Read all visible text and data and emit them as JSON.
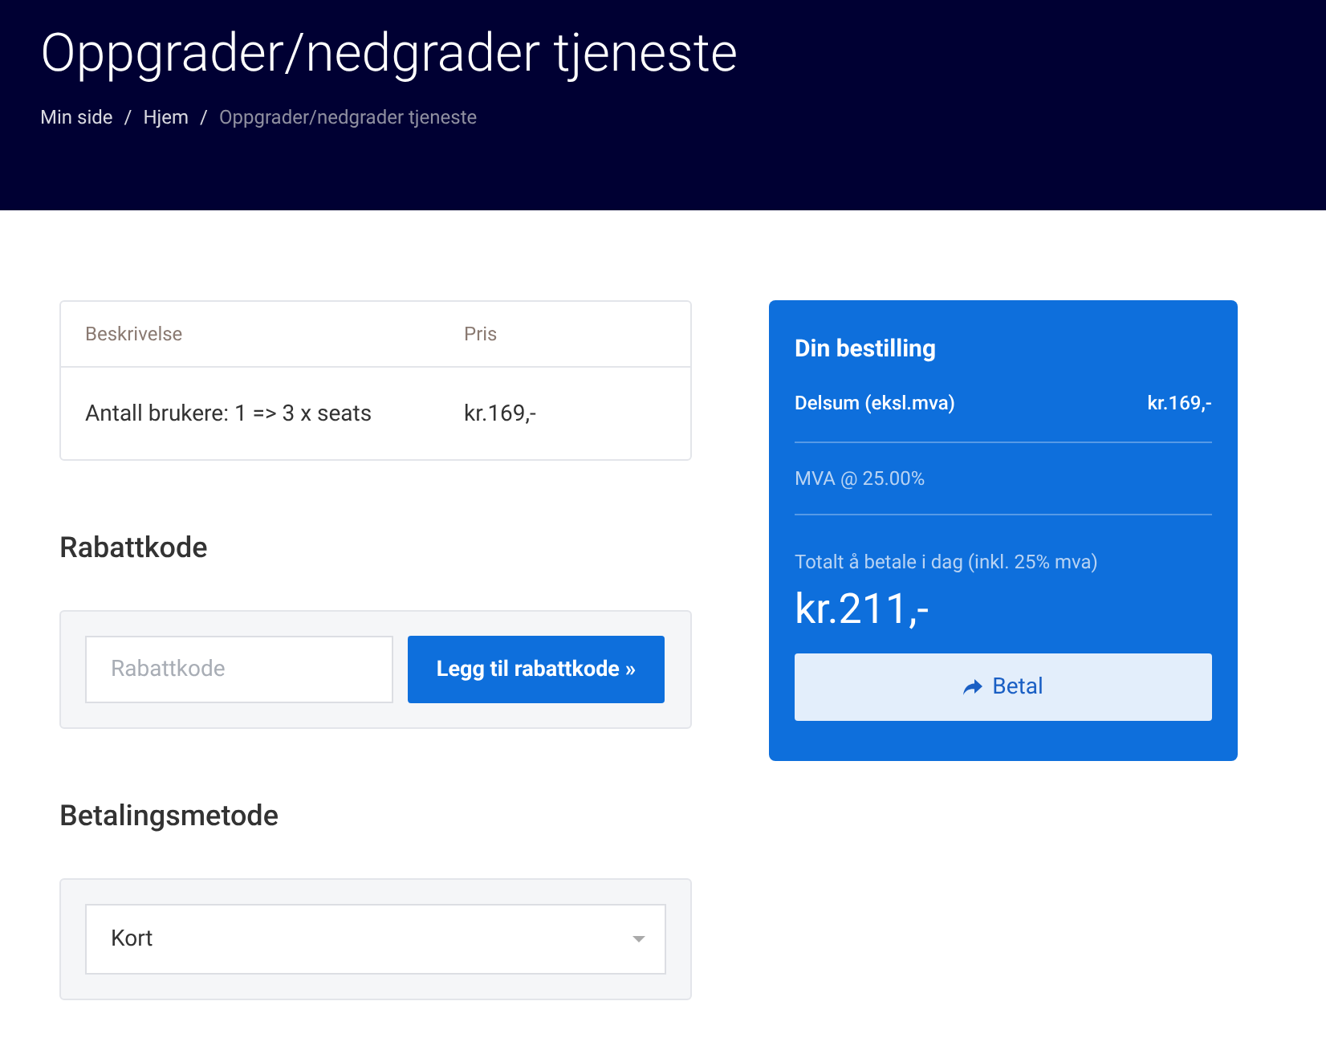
{
  "header": {
    "title": "Oppgrader/nedgrader tjeneste",
    "breadcrumbs": [
      {
        "label": "Min side",
        "kind": "link",
        "separator": "/"
      },
      {
        "label": "Hjem",
        "kind": "link",
        "separator": "/"
      },
      {
        "label": "Oppgrader/nedgrader tjeneste",
        "kind": "current"
      }
    ]
  },
  "table": {
    "columns": [
      "Beskrivelse",
      "Pris"
    ],
    "rows": [
      [
        "Antall brukere: 1 => 3 x seats",
        "kr.169,-"
      ]
    ]
  },
  "discount": {
    "heading": "Rabattkode",
    "placeholder": "Rabattkode",
    "button": "Legg til rabattkode »"
  },
  "payment": {
    "heading": "Betalingsmetode",
    "value": "Kort"
  },
  "order": {
    "title": "Din bestilling",
    "lines": [
      {
        "kind": "subtotal",
        "label": "Delsum (eksl.mva)",
        "value": "kr.169,-"
      },
      {
        "kind": "tax",
        "label": "MVA @ 25.00%"
      }
    ],
    "total_label": "Totalt å betale i dag (inkl. 25% mva)",
    "total": "kr.211,-",
    "button": "Betal"
  }
}
